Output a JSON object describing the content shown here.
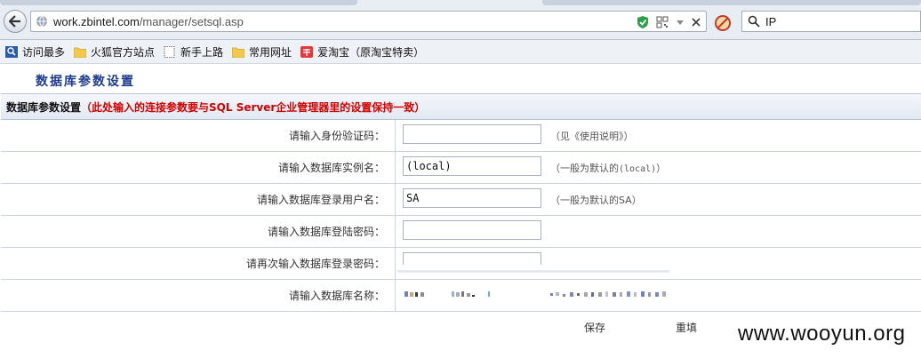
{
  "browser": {
    "url_host": "work.zbintel.com",
    "url_path": "/manager/setsql.asp",
    "search_value": "IP"
  },
  "bookmarks": [
    {
      "label": "访问最多",
      "icon": "search-icon"
    },
    {
      "label": "火狐官方站点",
      "icon": "folder-icon"
    },
    {
      "label": "新手上路",
      "icon": "page-icon"
    },
    {
      "label": "常用网址",
      "icon": "folder-icon"
    },
    {
      "label": "爱淘宝（原淘宝特卖）",
      "icon": "taobao-icon"
    }
  ],
  "page": {
    "title": "数据库参数设置",
    "header_main": "数据库参数设置",
    "header_note_open": "（",
    "header_note": "此处输入的连接参数要与SQL Server企业管理器里的设置保持一致",
    "header_note_close": "）"
  },
  "form": {
    "rows": [
      {
        "label": "请输入身份验证码：",
        "value": "",
        "hint": "（见《使用说明》）"
      },
      {
        "label": "请输入数据库实例名：",
        "value": "(local)",
        "hint_pre": "（一般为默认的",
        "hint_mono": "(local)",
        "hint_post": "）"
      },
      {
        "label": "请输入数据库登录用户名：",
        "value": "SA",
        "hint": "（一般为默认的SA）"
      },
      {
        "label": "请输入数据库登陆密码：",
        "value": ""
      },
      {
        "label": "请再次输入数据库登录密码：",
        "value": ""
      },
      {
        "label": "请输入数据库名称：",
        "value": ""
      }
    ],
    "save_label": "保存",
    "reset_label": "重填"
  },
  "watermark": "www.wooyun.org",
  "colors": {
    "title": "#1f3c8f",
    "note_red": "#d40000"
  }
}
